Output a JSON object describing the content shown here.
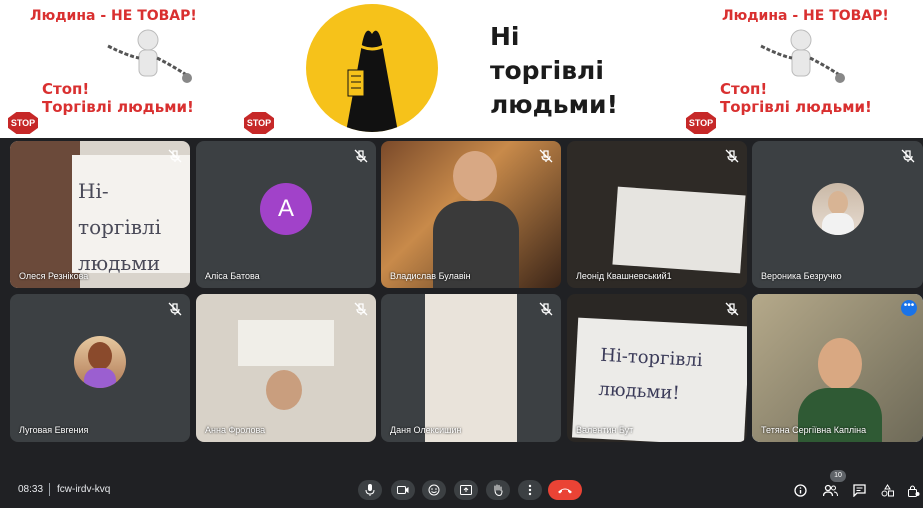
{
  "banner": {
    "left_poster": {
      "title": "Людина - НЕ ТОВАР!",
      "stop_line": "Стоп!",
      "trade_line": "Торгівлі людьми!",
      "stop_sign": "STOP"
    },
    "center_poster": {
      "line1": "Ні",
      "line2": "торгівлі",
      "line3": "людьми!"
    },
    "right_poster": {
      "title": "Людина - НЕ ТОВАР!",
      "stop_line": "Стоп!",
      "trade_line": "Торгівлі людьми!",
      "stop_sign": "STOP"
    }
  },
  "participants": [
    {
      "name": "Олеся Резнікова",
      "muted": true,
      "sign_text": "Ні-торгівлі людьми"
    },
    {
      "name": "Аліса Батова",
      "muted": true,
      "avatar_letter": "A"
    },
    {
      "name": "Владислав Булавін",
      "muted": true
    },
    {
      "name": "Леонід Квашневський1",
      "muted": true
    },
    {
      "name": "Вероника Безручко",
      "muted": true
    },
    {
      "name": "Луговая Евгения",
      "muted": true
    },
    {
      "name": "Анна Фролова",
      "muted": true
    },
    {
      "name": "Даня Олексишин",
      "muted": true
    },
    {
      "name": "Валентин Бут",
      "muted": true,
      "sign_text": "Ні-торгівлі людьми!"
    },
    {
      "name": "Тетяна Сергіївна Капліна",
      "muted": false,
      "active": true
    }
  ],
  "bottom_bar": {
    "time": "08:33",
    "meeting_code": "fcw-irdv-kvq",
    "participant_count": "10",
    "controls": [
      "mic-icon",
      "camera-icon",
      "emoji-icon",
      "present-icon",
      "raise-hand-icon",
      "more-options-icon",
      "end-call-icon"
    ],
    "right_controls": [
      "info-icon",
      "people-icon",
      "chat-icon",
      "activities-icon",
      "host-controls-icon"
    ]
  },
  "colors": {
    "background": "#202124",
    "tile": "#3c4043",
    "end_call": "#ea4335",
    "active_outline": "#8ab4f8",
    "avatar_purple": "#a142c9",
    "poster_red": "#d93030"
  }
}
